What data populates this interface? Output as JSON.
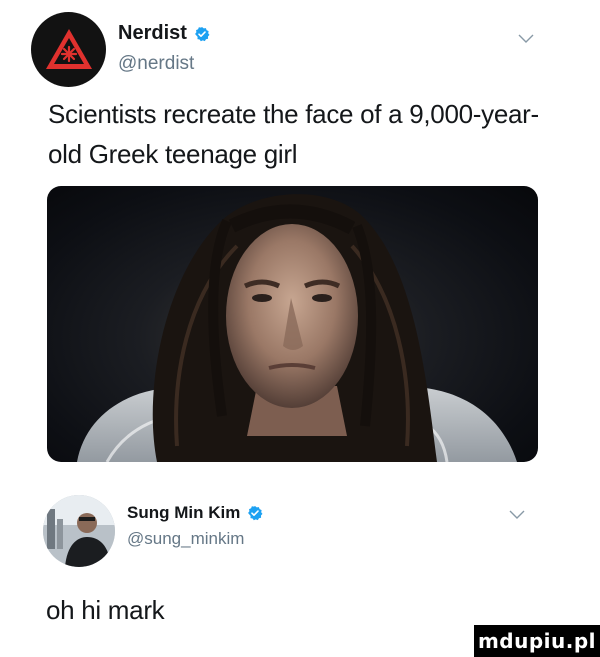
{
  "tweet": {
    "author": {
      "name": "Nerdist",
      "handle": "@nerdist",
      "verified": true,
      "avatar_icon": "warning-triangle-logo-icon"
    },
    "text": "Scientists recreate the face of a 9,000-year-old Greek teenage girl",
    "media": {
      "type": "photo",
      "icon": "photo-reconstructed-face"
    }
  },
  "reply": {
    "author": {
      "name": "Sung Min Kim",
      "handle": "@sung_minkim",
      "verified": true,
      "avatar_icon": "user-avatar-photo"
    },
    "text": "oh hi mark"
  },
  "watermark": {
    "text": "mdupiu.pl"
  },
  "colors": {
    "text": "#14171a",
    "secondary": "#657786",
    "verified": "#1da1f2",
    "watermark_bg": "#000000"
  }
}
